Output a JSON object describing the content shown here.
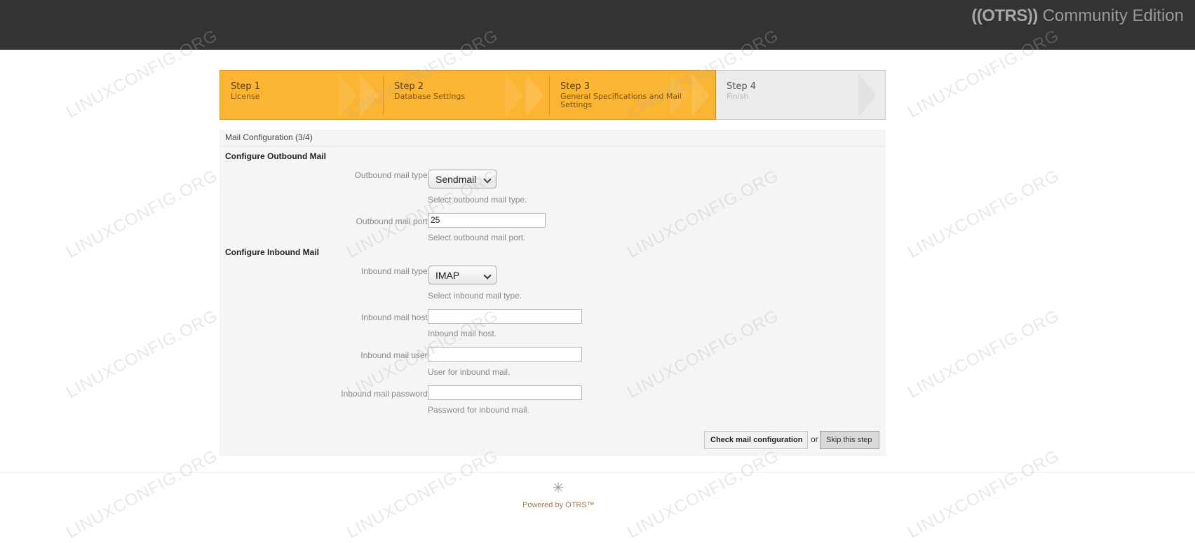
{
  "header": {
    "brand_mark": "((OTRS))",
    "brand_edition": "Community Edition"
  },
  "steps": [
    {
      "title": "Step 1",
      "sub": "License",
      "state": "done"
    },
    {
      "title": "Step 2",
      "sub": "Database Settings",
      "state": "done"
    },
    {
      "title": "Step 3",
      "sub": "General Specifications and Mail Settings",
      "state": "current"
    },
    {
      "title": "Step 4",
      "sub": "Finish",
      "state": "pending"
    }
  ],
  "panel": {
    "title": "Mail Configuration (3/4)",
    "outbound": {
      "heading": "Configure Outbound Mail",
      "type_label": "Outbound mail type:",
      "type_value": "Sendmail",
      "type_hint": "Select outbound mail type.",
      "port_label": "Outbound mail port:",
      "port_value": "25",
      "port_hint": "Select outbound mail port."
    },
    "inbound": {
      "heading": "Configure Inbound Mail",
      "type_label": "Inbound mail type:",
      "type_value": "IMAP",
      "type_hint": "Select inbound mail type.",
      "host_label": "Inbound mail host:",
      "host_value": "",
      "host_hint": "Inbound mail host.",
      "user_label": "Inbound mail user:",
      "user_value": "",
      "user_hint": "User for inbound mail.",
      "password_label": "Inbound mail password:",
      "password_value": "",
      "password_hint": "Password for inbound mail."
    },
    "actions": {
      "check_label": "Check mail configuration",
      "or_text": "or",
      "skip_label": "Skip this step"
    }
  },
  "footer": {
    "icon": "otrs-star-icon",
    "powered": "Powered by OTRS™"
  },
  "watermark": "LINUXCONFIG.ORG",
  "colors": {
    "header_bg": "#333333",
    "step_active": "#fbb533",
    "step_pending": "#ececec",
    "panel_bg": "#f5f5f5"
  }
}
